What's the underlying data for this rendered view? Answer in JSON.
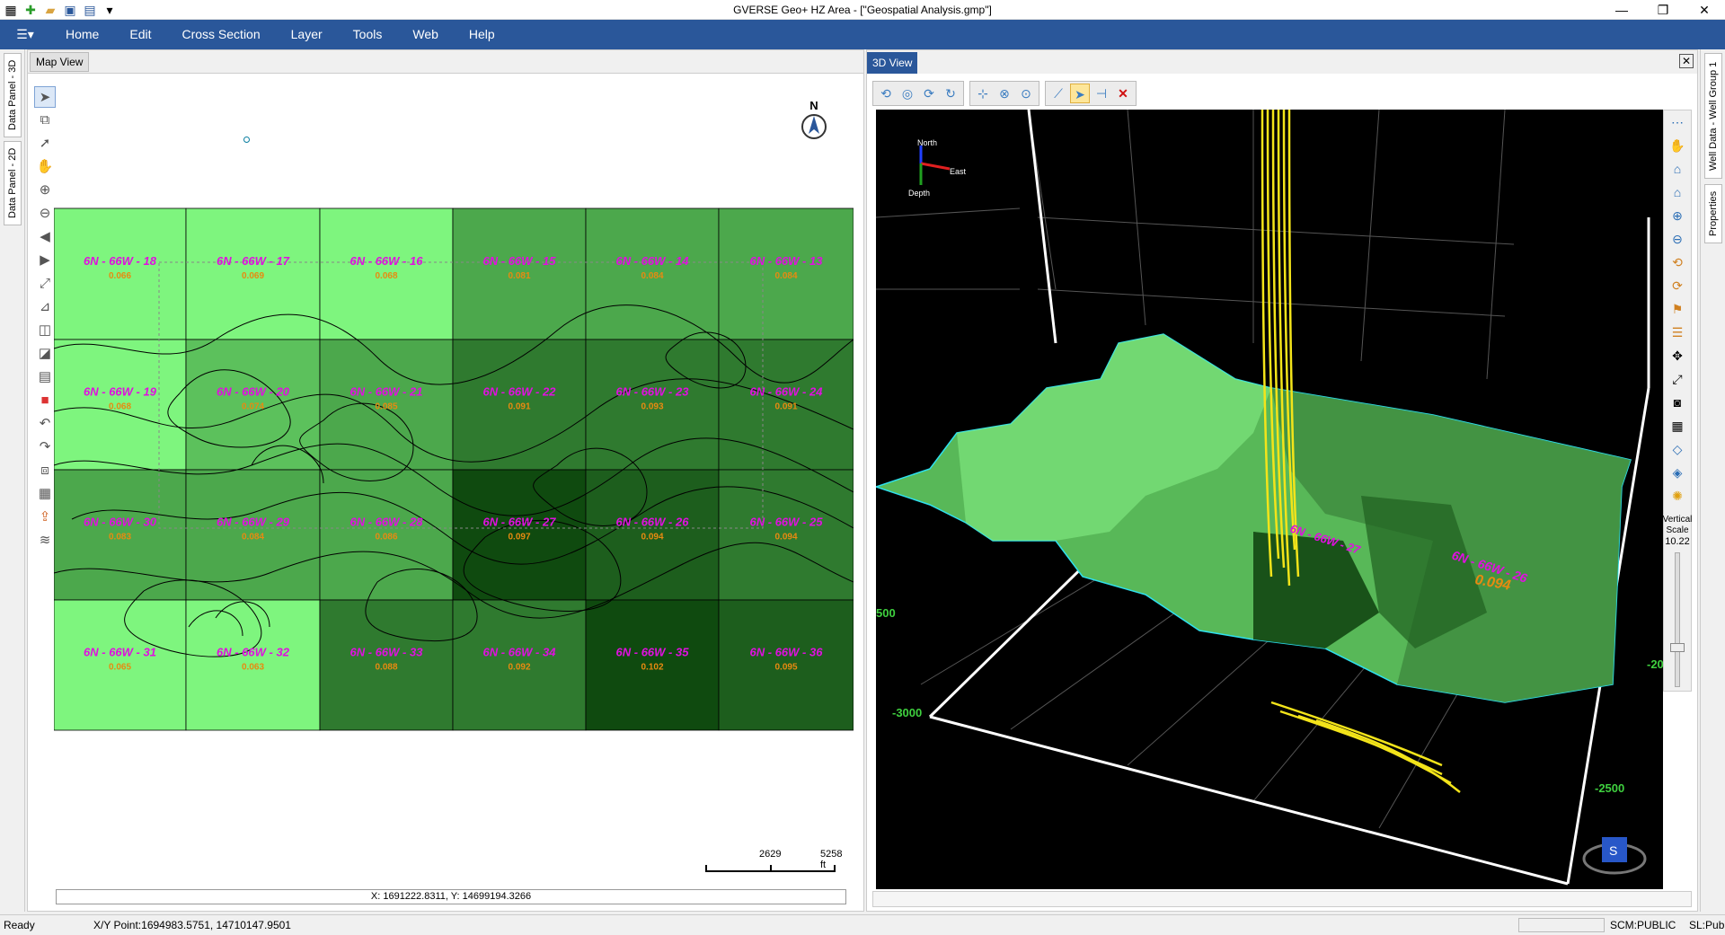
{
  "titlebar": {
    "title": "GVERSE Geo+    HZ Area - [\"Geospatial Analysis.gmp\"]"
  },
  "menu": {
    "items": [
      "Home",
      "Edit",
      "Cross Section",
      "Layer",
      "Tools",
      "Web",
      "Help"
    ]
  },
  "left_tabs": {
    "t3d": "Data Panel - 3D",
    "t2d": "Data Panel - 2D"
  },
  "right_tabs": {
    "well": "Well Data - Well Group 1",
    "props": "Properties"
  },
  "map": {
    "tab": "Map View",
    "north": "N",
    "scale": {
      "mid": "2629",
      "end": "5258 ft"
    },
    "coords": "X: 1691222.8311, Y: 14699194.3266",
    "cells": [
      {
        "label": "6N - 66W - 18",
        "value": "0.066",
        "shade": "#7ef57e"
      },
      {
        "label": "6N - 66W - 17",
        "value": "0.069",
        "shade": "#7ef57e"
      },
      {
        "label": "6N - 66W - 16",
        "value": "0.068",
        "shade": "#7ef57e"
      },
      {
        "label": "6N - 66W - 15",
        "value": "0.081",
        "shade": "#4ca84c"
      },
      {
        "label": "6N - 66W - 14",
        "value": "0.084",
        "shade": "#4ca84c"
      },
      {
        "label": "6N - 66W - 13",
        "value": "0.084",
        "shade": "#4ca84c"
      },
      {
        "label": "6N - 66W - 19",
        "value": "0.068",
        "shade": "#7ef57e"
      },
      {
        "label": "6N - 66W - 20",
        "value": "0.074",
        "shade": "#5cc15c"
      },
      {
        "label": "6N - 66W - 21",
        "value": "0.085",
        "shade": "#4ca84c"
      },
      {
        "label": "6N - 66W - 22",
        "value": "0.091",
        "shade": "#2f7a2f"
      },
      {
        "label": "6N - 66W - 23",
        "value": "0.093",
        "shade": "#2f7a2f"
      },
      {
        "label": "6N - 66W - 24",
        "value": "0.091",
        "shade": "#2f7a2f"
      },
      {
        "label": "6N - 66W - 30",
        "value": "0.083",
        "shade": "#4ca84c"
      },
      {
        "label": "6N - 66W - 29",
        "value": "0.084",
        "shade": "#4ca84c"
      },
      {
        "label": "6N - 66W - 28",
        "value": "0.086",
        "shade": "#4ca84c"
      },
      {
        "label": "6N - 66W - 27",
        "value": "0.097",
        "shade": "#0f4a0f"
      },
      {
        "label": "6N - 66W - 26",
        "value": "0.094",
        "shade": "#1d5e1d"
      },
      {
        "label": "6N - 66W - 25",
        "value": "0.094",
        "shade": "#2f7a2f"
      },
      {
        "label": "6N - 66W - 31",
        "value": "0.065",
        "shade": "#7ef57e"
      },
      {
        "label": "6N - 66W - 32",
        "value": "0.063",
        "shade": "#7ef57e"
      },
      {
        "label": "6N - 66W - 33",
        "value": "0.088",
        "shade": "#2f7a2f"
      },
      {
        "label": "6N - 66W - 34",
        "value": "0.092",
        "shade": "#2f7a2f"
      },
      {
        "label": "6N - 66W - 35",
        "value": "0.102",
        "shade": "#0f4a0f"
      },
      {
        "label": "6N - 66W - 36",
        "value": "0.095",
        "shade": "#1d5e1d"
      }
    ]
  },
  "view3d": {
    "tab": "3D View",
    "axis": {
      "north": "North",
      "east": "East",
      "depth": "Depth"
    },
    "ticks": {
      "a": "500",
      "b": "-3000",
      "c": "-2500",
      "d": "-20"
    },
    "labels": {
      "l1": "6N - 66W - 27",
      "l2": "6N - 66W - 26",
      "l3": "0.094"
    },
    "vertical_scale": {
      "label": "Vertical Scale",
      "value": "10.22"
    },
    "cube": "S"
  },
  "status": {
    "ready": "Ready",
    "xy": "X/Y Point:1694983.5751, 14710147.9501",
    "scm": "SCM:PUBLIC",
    "sl": "SL:Public"
  },
  "colors": {
    "menubar": "#2a579a",
    "label_magenta": "#e010e0",
    "value_orange": "#e88a10"
  }
}
